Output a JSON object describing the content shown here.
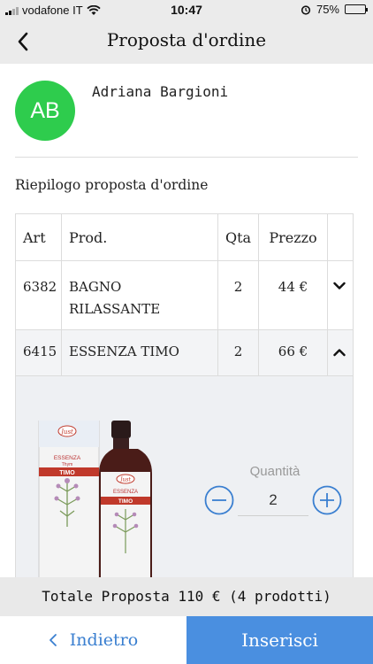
{
  "status_bar": {
    "carrier": "vodafone IT",
    "time": "10:47",
    "battery": "75%",
    "battery_level": 0.75
  },
  "nav": {
    "title": "Proposta d'ordine"
  },
  "customer": {
    "initials": "AB",
    "name": "Adriana Bargioni",
    "avatar_color": "#2ecc4d"
  },
  "summary": {
    "title": "Riepilogo proposta d'ordine"
  },
  "table": {
    "headers": [
      "Art",
      "Prod.",
      "Qta",
      "Prezzo"
    ],
    "rows": [
      {
        "art": "6382",
        "prod_line1": "BAGNO",
        "prod_line2": "RILASSANTE",
        "qta": "2",
        "prezzo": "44 €",
        "expanded": false
      },
      {
        "art": "6415",
        "prod": "ESSENZA TIMO",
        "qta": "2",
        "prezzo": "66 €",
        "expanded": true
      }
    ]
  },
  "detail": {
    "qty_label": "Quantità",
    "qty_value": "2",
    "product_image": {
      "brand": "Just",
      "product": "ESSENZA",
      "variant": "TIMO",
      "subtitle": "Thym"
    }
  },
  "total": {
    "text": "Totale Proposta 110 € (4 prodotti)"
  },
  "buttons": {
    "back_label": "Indietro",
    "insert_label": "Inserisci"
  },
  "colors": {
    "accent": "#4a8fe0",
    "link": "#3a7fd0"
  }
}
